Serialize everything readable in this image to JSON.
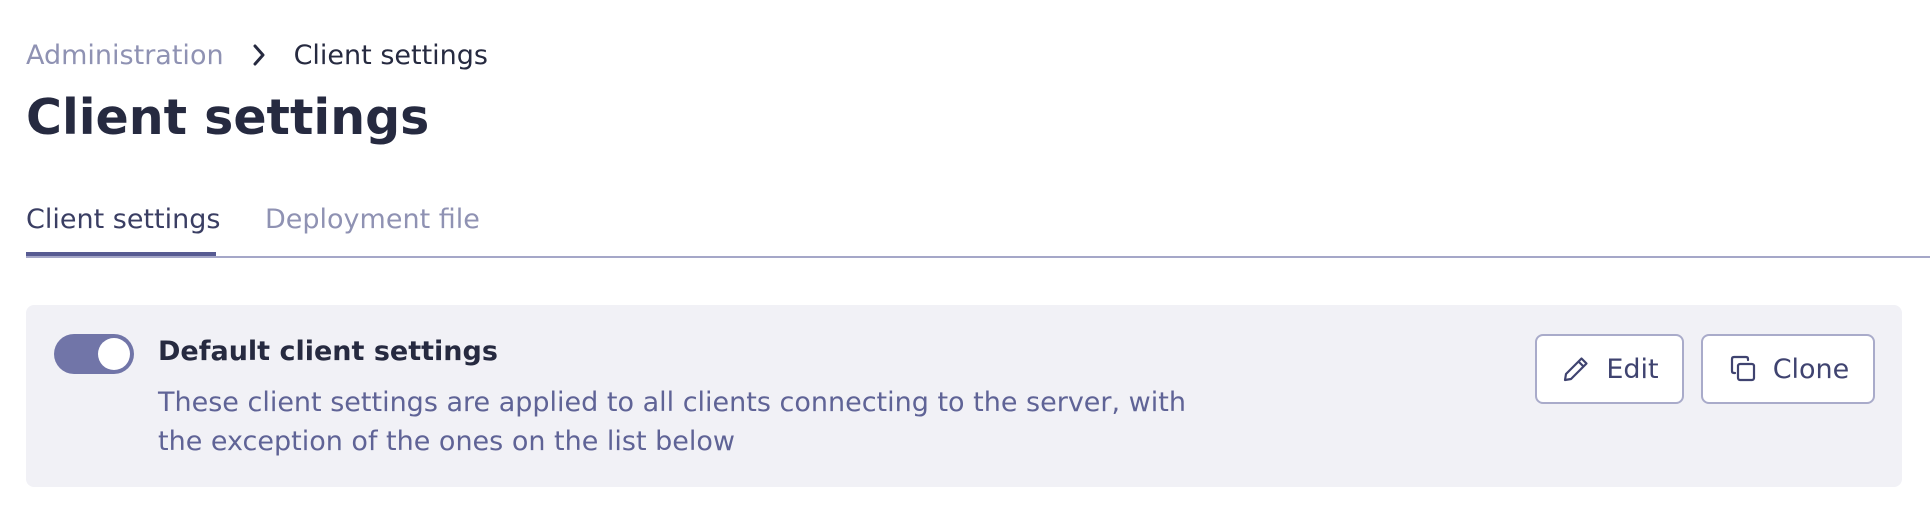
{
  "breadcrumb": {
    "parent": "Administration",
    "separator_icon": "chevron-right-icon",
    "current": "Client settings"
  },
  "page_title": "Client settings",
  "tabs": [
    {
      "label": "Client settings",
      "active": true
    },
    {
      "label": "Deployment file",
      "active": false
    }
  ],
  "default_settings": {
    "enabled": true,
    "title": "Default client settings",
    "description": "These client settings are applied to all clients connecting to the server, with the exception of the ones on the list below",
    "edit_label": "Edit",
    "edit_icon": "pencil-icon",
    "clone_label": "Clone",
    "clone_icon": "copy-icon"
  },
  "colors": {
    "accent": "#575b92",
    "toggle_on": "#7175a8",
    "card_background": "#f1f1f6",
    "muted_text": "#8f92b3"
  }
}
